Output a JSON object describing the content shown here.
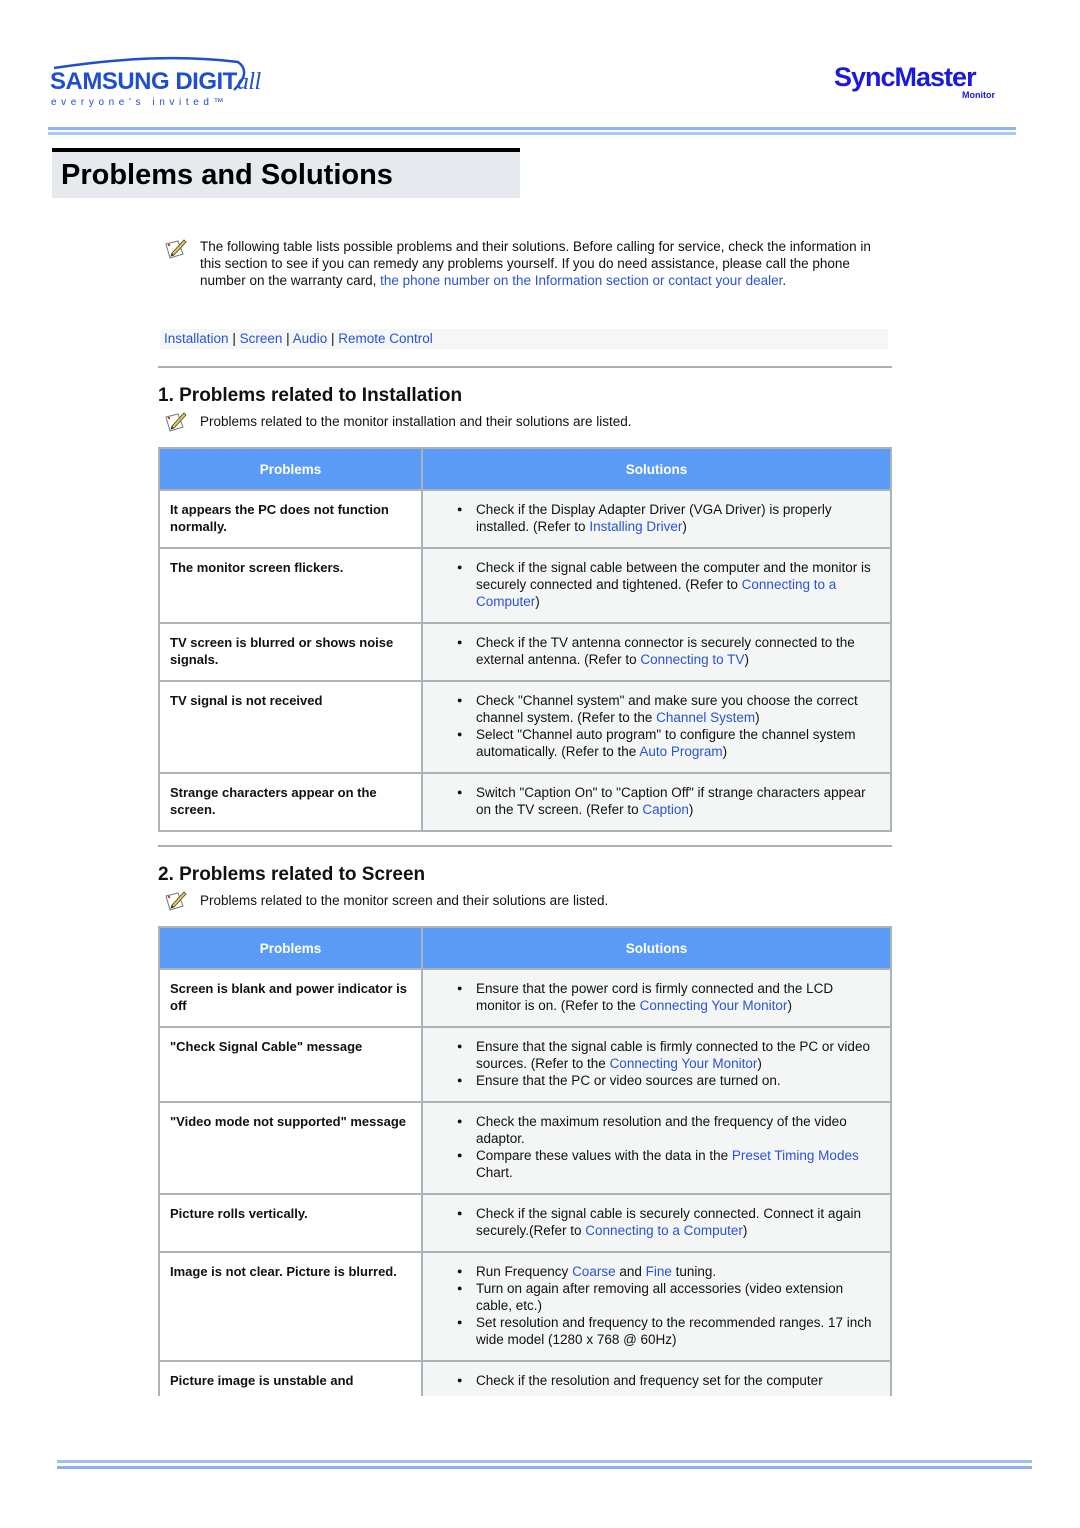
{
  "header": {
    "brand_word": "SAMSUNG DIGIT",
    "brand_word_italic": "all",
    "brand_tagline": "everyone's invited™",
    "product_logo": "SyncMaster",
    "product_sub": "Monitor",
    "accent_color": "#1f4fd0"
  },
  "page_title": "Problems and Solutions",
  "intro": {
    "icon": "note-pencil-icon",
    "text": "The following table lists possible problems and their solutions. Before calling for service, check the information in this section to see if you can remedy any problems yourself. If you do need assistance, please call the phone number on the warranty card, ",
    "link": "the phone number on the Information section or contact your dealer",
    "text_end": "."
  },
  "nav": {
    "items": [
      "Installation",
      "Screen",
      "Audio",
      "Remote Control"
    ],
    "separator": "|"
  },
  "table_headers": {
    "problems": "Problems",
    "solutions": "Solutions"
  },
  "sections": [
    {
      "heading": "1. Problems related to Installation",
      "description": "Problems related to the monitor installation and their solutions are listed.",
      "rows": [
        {
          "problem": "It appears the PC does not function normally.",
          "solutions": [
            {
              "pre": "Check if the Display Adapter Driver (VGA Driver) is properly installed. (Refer to ",
              "link": "Installing Driver",
              "post": ")"
            }
          ]
        },
        {
          "problem": "The monitor screen flickers.",
          "solutions": [
            {
              "pre": "Check if the signal cable between the computer and the monitor is securely connected and tightened. (Refer to ",
              "link": "Connecting to a Computer",
              "post": ")"
            }
          ]
        },
        {
          "problem": "TV screen is blurred or shows noise signals.",
          "solutions": [
            {
              "pre": "Check if the TV antenna connector is securely connected to the external antenna. (Refer to ",
              "link": "Connecting to TV",
              "post": ")"
            }
          ]
        },
        {
          "problem": "TV signal is not received",
          "solutions": [
            {
              "pre": "Check \"Channel system\" and make sure you choose the correct channel system. (Refer to the ",
              "link": "Channel System",
              "post": ")"
            },
            {
              "pre": "Select \"Channel auto program\" to configure the channel system automatically. (Refer to the ",
              "link": "Auto Program",
              "post": ")"
            }
          ]
        },
        {
          "problem": "Strange characters appear on the screen.",
          "solutions": [
            {
              "pre": "Switch \"Caption On\" to \"Caption Off\" if strange characters appear on the TV screen. (Refer to ",
              "link": "Caption",
              "post": ")"
            }
          ]
        }
      ]
    },
    {
      "heading": "2. Problems related to Screen",
      "description": "Problems related to the monitor screen and their solutions are listed.",
      "rows": [
        {
          "problem": "Screen is blank and power indicator is off",
          "solutions": [
            {
              "pre": "Ensure that the power cord is firmly connected and the LCD monitor is on. (Refer to the ",
              "link": "Connecting Your Monitor",
              "post": ")"
            }
          ]
        },
        {
          "problem": "\"Check Signal Cable\" message",
          "solutions": [
            {
              "pre": "Ensure that the signal cable is firmly connected to the PC or video sources. (Refer to the ",
              "link": "Connecting Your Monitor",
              "post": ")"
            },
            {
              "pre": "Ensure that the PC or video sources are turned on.",
              "link": "",
              "post": ""
            }
          ]
        },
        {
          "problem": "\"Video mode not supported\" message",
          "solutions": [
            {
              "pre": "Check the maximum resolution and the frequency of the video adaptor.",
              "link": "",
              "post": ""
            },
            {
              "pre": "Compare these values with the data in the ",
              "link": "Preset Timing Modes",
              "post": " Chart."
            }
          ]
        },
        {
          "problem": "Picture rolls vertically.",
          "solutions": [
            {
              "pre": "Check if the signal cable is securely connected. Connect it again securely.(Refer to ",
              "link": "Connecting to a Computer",
              "post": ")"
            }
          ]
        },
        {
          "problem": "Image is not clear. Picture is blurred.",
          "solutions": [
            {
              "pre": "Run Frequency ",
              "link": "Coarse",
              "mid": " and ",
              "link2": "Fine",
              "post": " tuning."
            },
            {
              "pre": "Turn on again after removing all accessories (video extension cable, etc.)",
              "link": "",
              "post": ""
            },
            {
              "pre": "Set resolution and frequency to the recommended ranges. 17 inch wide model (1280 x 768 @ 60Hz)",
              "link": "",
              "post": ""
            }
          ]
        },
        {
          "problem": "Picture image is unstable and",
          "solutions": [
            {
              "pre": "Check if the resolution and frequency set for the computer",
              "link": "",
              "post": ""
            }
          ]
        }
      ]
    }
  ]
}
